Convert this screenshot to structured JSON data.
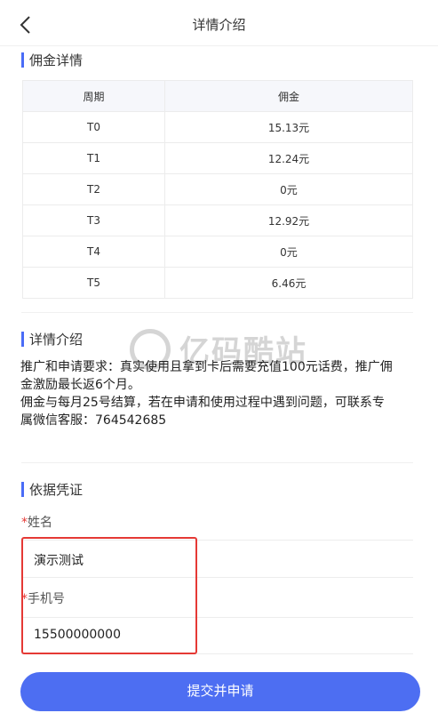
{
  "header": {
    "title": "详情介绍"
  },
  "commission": {
    "section_title": "佣金详情",
    "columns": [
      "周期",
      "佣金"
    ],
    "rows": [
      [
        "T0",
        "15.13元"
      ],
      [
        "T1",
        "12.24元"
      ],
      [
        "T2",
        "0元"
      ],
      [
        "T3",
        "12.92元"
      ],
      [
        "T4",
        "0元"
      ],
      [
        "T5",
        "6.46元"
      ]
    ]
  },
  "details": {
    "section_title": "详情介绍",
    "lines": [
      "推广和申请要求：真实使用且拿到卡后需要充值100元话费，推广佣",
      "金激励最长返6个月。",
      "佣金与每月25号结算，若在申请和使用过程中遇到问题，可联系专",
      "属微信客服：764542685"
    ]
  },
  "evidence": {
    "section_title": "依据凭证",
    "name_label": "姓名",
    "name_value": "演示测试",
    "phone_label": "手机号",
    "phone_value": "15500000000",
    "required_mark": "*"
  },
  "submit_label": "提交并申请",
  "watermark": {
    "text": "亿码酷站"
  },
  "colors": {
    "accent": "#4d6ef2",
    "required": "#e53935",
    "highlight": "#e53935"
  }
}
